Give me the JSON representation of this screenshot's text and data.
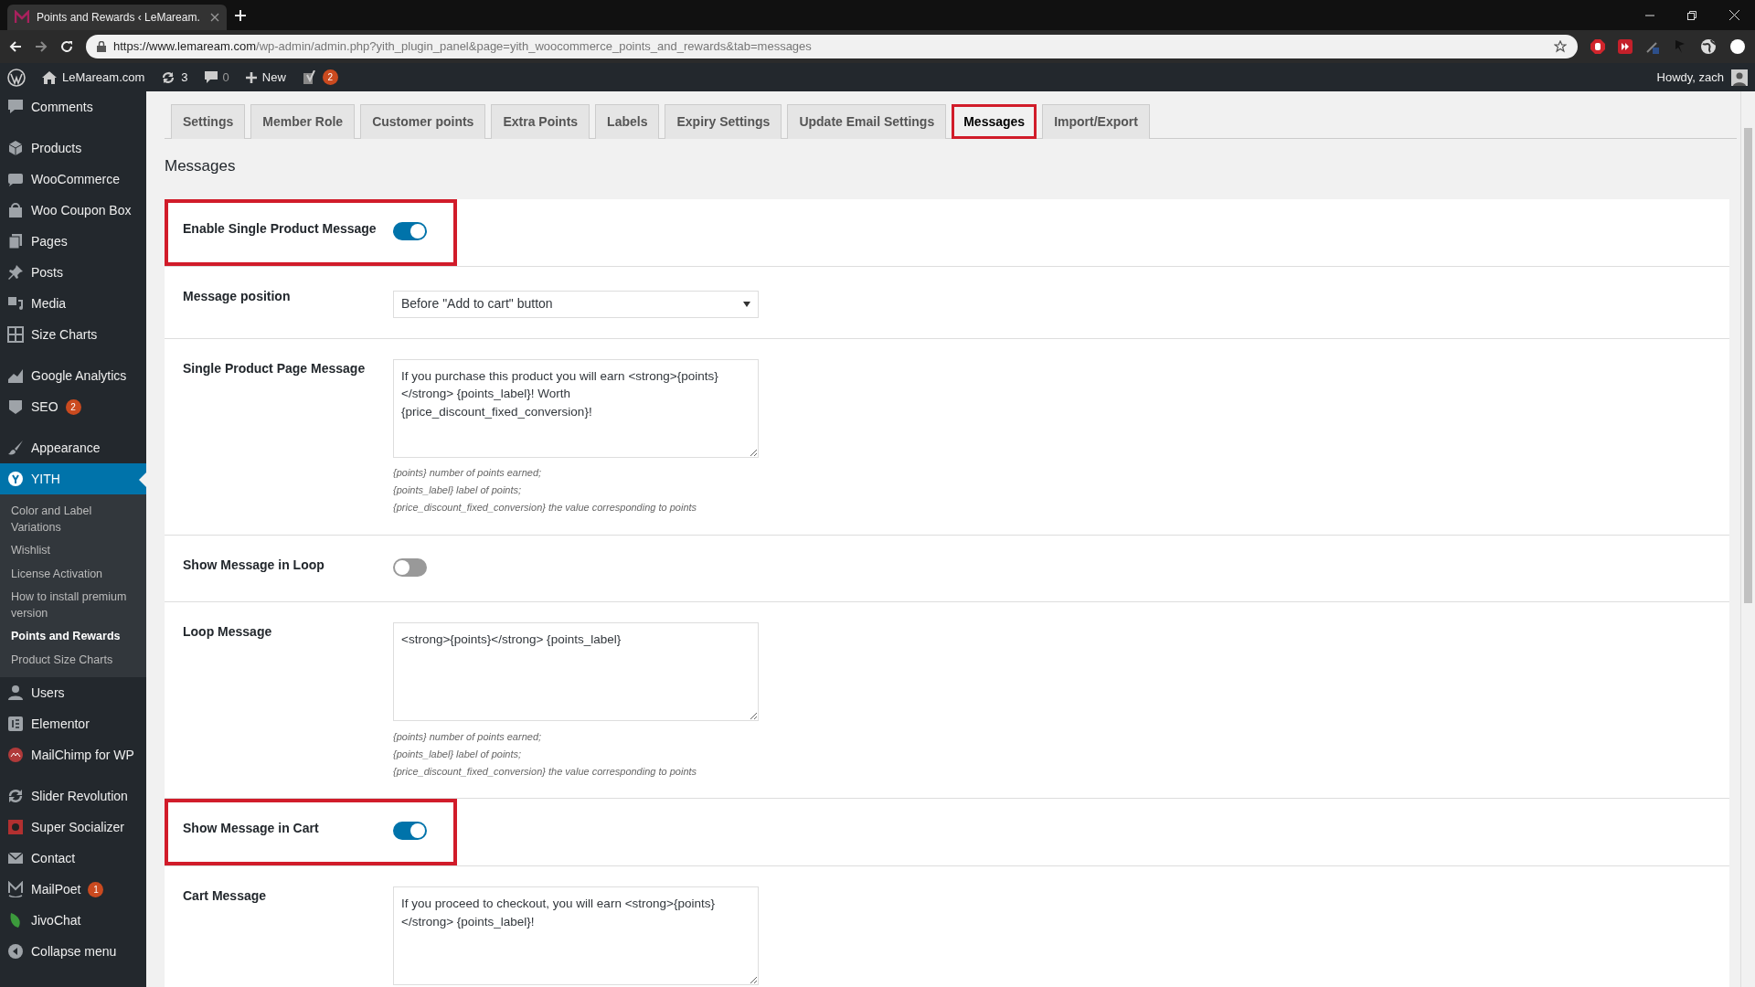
{
  "browser": {
    "tab_title": "Points and Rewards ‹ LeMaream.",
    "url_host": "https://www.lemaream.com",
    "url_path": "/wp-admin/admin.php?yith_plugin_panel&page=yith_woocommerce_points_and_rewards&tab=messages"
  },
  "admin_bar": {
    "site": "LeMaream.com",
    "updates": "3",
    "comments": "0",
    "new": "New",
    "seo_badge": "2",
    "greeting": "Howdy, zach"
  },
  "sidebar": {
    "items": [
      {
        "kind": "item",
        "label": "Comments",
        "selected": false
      },
      {
        "kind": "separator"
      },
      {
        "kind": "item",
        "label": "Products",
        "selected": false
      },
      {
        "kind": "item",
        "label": "WooCommerce",
        "selected": false
      },
      {
        "kind": "item",
        "label": "Woo Coupon Box",
        "selected": false
      },
      {
        "kind": "item",
        "label": "Pages",
        "selected": false
      },
      {
        "kind": "item",
        "label": "Posts",
        "selected": false
      },
      {
        "kind": "item",
        "label": "Media",
        "selected": false
      },
      {
        "kind": "item",
        "label": "Size Charts",
        "selected": false
      },
      {
        "kind": "separator"
      },
      {
        "kind": "item",
        "label": "Google Analytics",
        "selected": false
      },
      {
        "kind": "item",
        "label": "SEO",
        "badge": "2",
        "selected": false
      },
      {
        "kind": "separator"
      },
      {
        "kind": "item",
        "label": "Appearance",
        "selected": false
      },
      {
        "kind": "item",
        "label": "YITH",
        "selected": true,
        "children": [
          {
            "label": "Color and Label Variations",
            "selected": false
          },
          {
            "label": "Wishlist",
            "selected": false
          },
          {
            "label": "License Activation",
            "selected": false
          },
          {
            "label": "How to install premium version",
            "selected": false
          },
          {
            "label": "Points and Rewards",
            "selected": true
          },
          {
            "label": "Product Size Charts",
            "selected": false
          }
        ]
      },
      {
        "kind": "item",
        "label": "Users",
        "selected": false
      },
      {
        "kind": "item",
        "label": "Elementor",
        "selected": false
      },
      {
        "kind": "item",
        "label": "MailChimp for WP",
        "selected": false
      },
      {
        "kind": "separator"
      },
      {
        "kind": "item",
        "label": "Slider Revolution",
        "selected": false
      },
      {
        "kind": "item",
        "label": "Super Socializer",
        "selected": false
      },
      {
        "kind": "item",
        "label": "Contact",
        "selected": false
      },
      {
        "kind": "item",
        "label": "MailPoet",
        "badge": "1",
        "selected": false
      },
      {
        "kind": "item",
        "label": "JivoChat",
        "selected": false
      },
      {
        "kind": "item",
        "label": "Collapse menu",
        "selected": false
      }
    ]
  },
  "tabs": [
    {
      "label": "Settings",
      "selected": false,
      "highlighted": false
    },
    {
      "label": "Member Role",
      "selected": false,
      "highlighted": false
    },
    {
      "label": "Customer points",
      "selected": false,
      "highlighted": false
    },
    {
      "label": "Extra Points",
      "selected": false,
      "highlighted": false
    },
    {
      "label": "Labels",
      "selected": false,
      "highlighted": false
    },
    {
      "label": "Expiry Settings",
      "selected": false,
      "highlighted": false
    },
    {
      "label": "Update Email Settings",
      "selected": false,
      "highlighted": false
    },
    {
      "label": "Messages",
      "selected": true,
      "highlighted": true
    },
    {
      "label": "Import/Export",
      "selected": false,
      "highlighted": false
    }
  ],
  "section_title": "Messages",
  "rows": [
    {
      "kind": "toggle",
      "label": "Enable Single Product Message",
      "on": true,
      "highlighted": true
    },
    {
      "kind": "select",
      "label": "Message position",
      "value": "Before \"Add to cart\" button",
      "highlighted": false
    },
    {
      "kind": "textarea",
      "label": "Single Product Page Message",
      "value": "If you purchase this product you will earn <strong>{points}</strong> {points_label}! Worth {price_discount_fixed_conversion}!",
      "help": [
        "{points} number of points earned;",
        "{points_label} label of points;",
        "{price_discount_fixed_conversion} the value corresponding to points"
      ],
      "highlighted": false
    },
    {
      "kind": "toggle",
      "label": "Show Message in Loop",
      "on": false,
      "highlighted": false
    },
    {
      "kind": "textarea",
      "label": "Loop Message",
      "value": "<strong>{points}</strong> {points_label}",
      "help": [
        "{points} number of points earned;",
        "{points_label} label of points;",
        "{price_discount_fixed_conversion} the value corresponding to points"
      ],
      "highlighted": false
    },
    {
      "kind": "toggle",
      "label": "Show Message in Cart",
      "on": true,
      "highlighted": true
    },
    {
      "kind": "textarea",
      "label": "Cart Message",
      "value": "If you proceed to checkout, you will earn <strong>{points}</strong> {points_label}!",
      "highlighted": false
    }
  ]
}
